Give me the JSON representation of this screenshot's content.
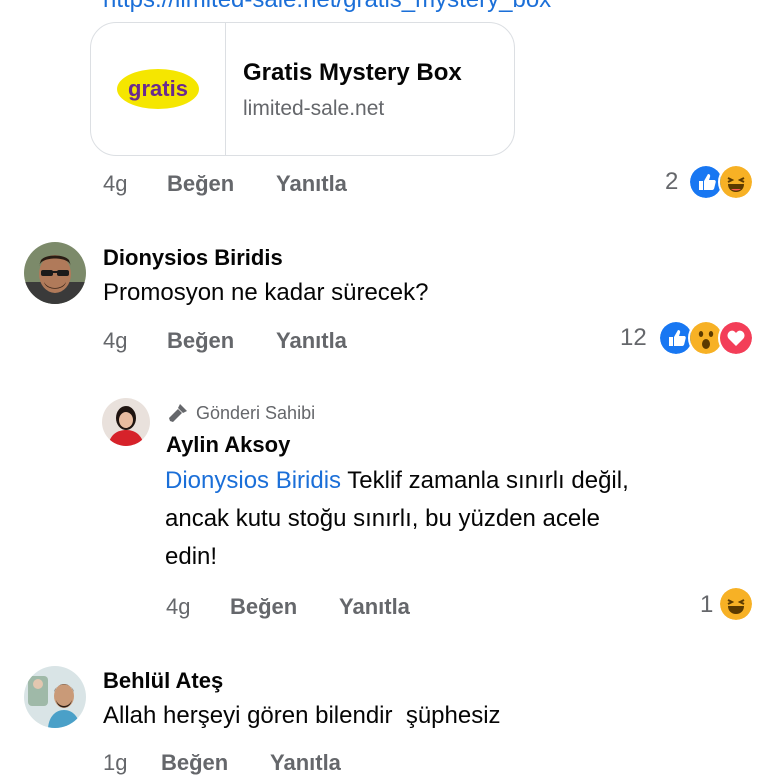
{
  "top_link": "https://limited-sale.net/gratis_mystery_box",
  "link_card": {
    "logo_text": "gratis",
    "title": "Gratis Mystery Box",
    "domain": "limited-sale.net"
  },
  "comments": [
    {
      "time": "4g",
      "like_label": "Beğen",
      "reply_label": "Yanıtla",
      "reaction_count": "2",
      "reactions": [
        "like-icon",
        "haha-icon"
      ]
    },
    {
      "author": "Dionysios Biridis",
      "text": "Promosyon ne kadar sürecek?",
      "time": "4g",
      "like_label": "Beğen",
      "reply_label": "Yanıtla",
      "reaction_count": "12",
      "reactions": [
        "like-icon",
        "wow-icon",
        "love-icon"
      ]
    },
    {
      "badge": "Gönderi Sahibi",
      "author": "Aylin Aksoy",
      "mention": "Dionysios Biridis",
      "text_line1": " Teklif zamanla sınırlı değil,",
      "text_line2": "ancak kutu stoğu sınırlı, bu yüzden acele",
      "text_line3": "edin!",
      "time": "4g",
      "like_label": "Beğen",
      "reply_label": "Yanıtla",
      "reaction_count": "1",
      "reactions": [
        "haha-icon"
      ]
    },
    {
      "author": "Behlül Ateş",
      "text": "Allah herşeyi gören bilendir  şüphesiz",
      "time": "1g",
      "like_label": "Beğen",
      "reply_label": "Yanıtla"
    }
  ],
  "colors": {
    "link_blue": "#1b6fd8",
    "meta_gray": "#65676b",
    "like_blue": "#1877f2",
    "love_red": "#f33e58",
    "emoji_yellow": "#f7b125",
    "gratis_yellow": "#f5e600",
    "gratis_purple": "#6a2a8f"
  }
}
